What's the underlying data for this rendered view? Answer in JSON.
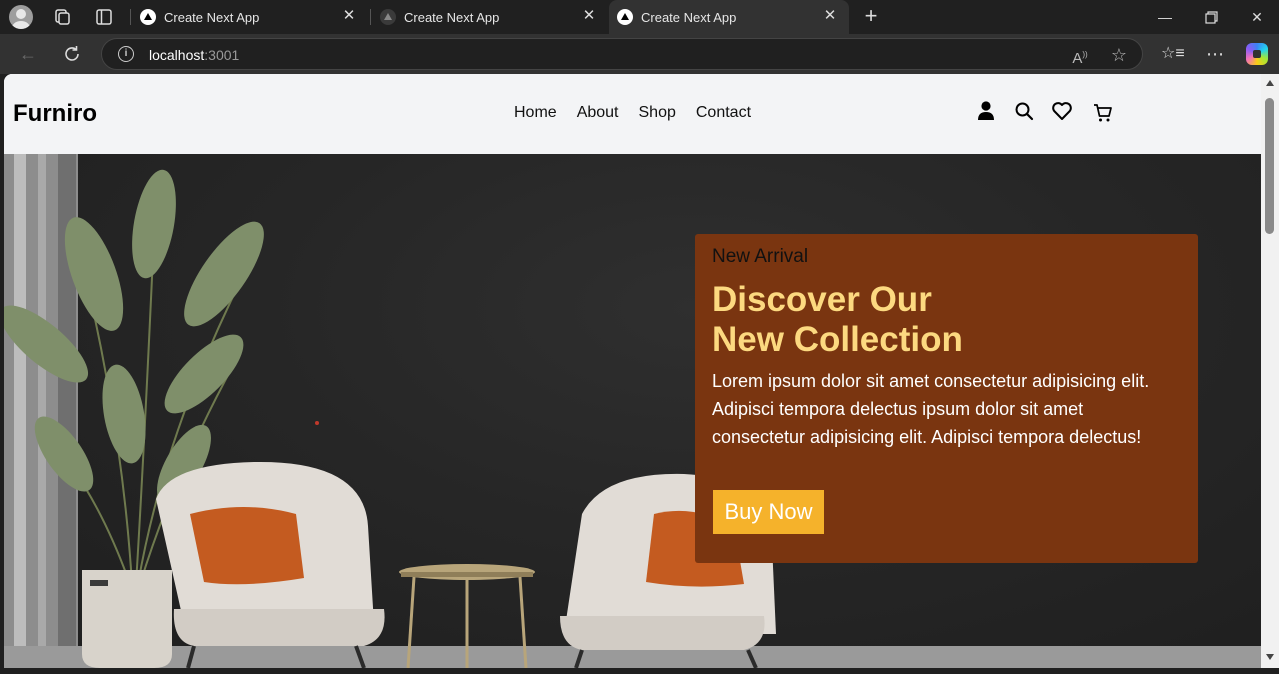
{
  "browser": {
    "tabs": [
      {
        "title": "Create Next App",
        "active": false
      },
      {
        "title": "Create Next App",
        "active": false
      },
      {
        "title": "Create Next App",
        "active": true
      }
    ],
    "address": {
      "host": "localhost",
      "port": ":3001"
    }
  },
  "site": {
    "logo": "Furniro",
    "nav": [
      "Home",
      "About",
      "Shop",
      "Contact"
    ],
    "header_icons": [
      "user-icon",
      "search-icon",
      "heart-icon",
      "cart-icon"
    ]
  },
  "hero": {
    "eyebrow": "New Arrival",
    "title_line1": "Discover Our",
    "title_line2": "New Collection",
    "body": "Lorem ipsum dolor sit amet consectetur adipisicing elit. Adipisci tempora delectus ipsum dolor sit amet consectetur adipisicing elit. Adipisci tempora delectus!",
    "cta": "Buy Now"
  },
  "colors": {
    "promo_bg": "#7a3510",
    "promo_title": "#fcd980",
    "cta_bg": "#f5b22b",
    "header_bg": "#f3f4f6"
  }
}
